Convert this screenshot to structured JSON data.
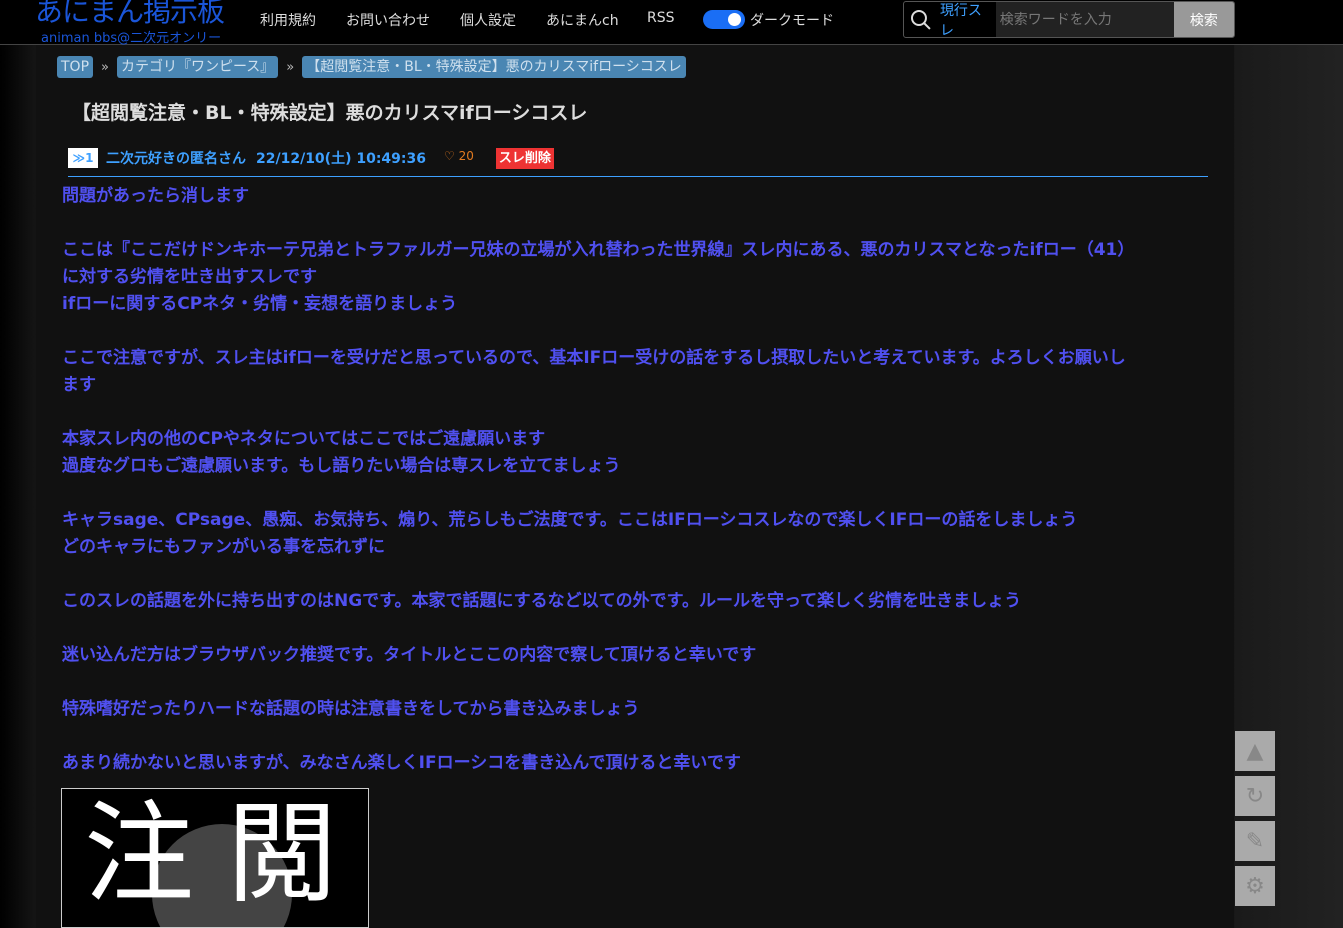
{
  "header": {
    "logo": "あにまん掲示板",
    "logo_sub": "animan bbs@二次元オンリー",
    "nav": [
      "利用規約",
      "お問い合わせ",
      "個人設定",
      "あにまんch",
      "RSS"
    ],
    "dark_mode_label": "ダークモード",
    "dark_mode_on": true,
    "search_scope": "現行スレ",
    "search_placeholder": "検索ワードを入力",
    "search_button": "検索"
  },
  "breadcrumb": [
    "TOP",
    "カテゴリ『ワンピース』",
    "【超閲覧注意・BL・特殊設定】悪のカリスマifローシコスレ"
  ],
  "breadcrumb_sep": "»",
  "thread": {
    "title": "【超閲覧注意・BL・特殊設定】悪のカリスマifローシコスレ",
    "post": {
      "number": "≫1",
      "author": "二次元好きの匿名さん",
      "datetime": "22/12/10(土) 10:49:36",
      "likes": "20",
      "delete_label": "スレ削除",
      "lines": [
        "問題があったら消します",
        "",
        "ここは『ここだけドンキホーテ兄弟とトラファルガー兄妹の立場が入れ替わった世界線』スレ内にある、悪のカリスマとなったifロー（41）",
        "に対する劣情を吐き出すスレです",
        "ifローに関するCPネタ・劣情・妄想を語りましょう",
        "",
        "ここで注意ですが、スレ主はifローを受けだと思っているので、基本IFロー受けの話をするし摂取したいと考えています。よろしくお願いし",
        "ます",
        "",
        "本家スレ内の他のCPやネタについてはここではご遠慮願います",
        "過度なグロもご遠慮願います。もし語りたい場合は専スレを立てましょう",
        "",
        "キャラsage、CPsage、愚痴、お気持ち、煽り、荒らしもご法度です。ここはIFローシコスレなので楽しくIFローの話をしましょう",
        "どのキャラにもファンがいる事を忘れずに",
        "",
        "このスレの話題を外に持ち出すのはNGです。本家で話題にするなど以ての外です。ルールを守って楽しく劣情を吐きましょう",
        "",
        "迷い込んだ方はブラウザバック推奨です。タイトルとここの内容で察して頂けると幸いです",
        "",
        "特殊嗜好だったりハードな話題の時は注意書きをしてから書き込みましょう",
        "",
        "あまり続かないと思いますが、みなさん楽しくIFローシコを書き込んで頂けると幸いです"
      ],
      "image_text": [
        "注",
        "閲"
      ]
    }
  }
}
